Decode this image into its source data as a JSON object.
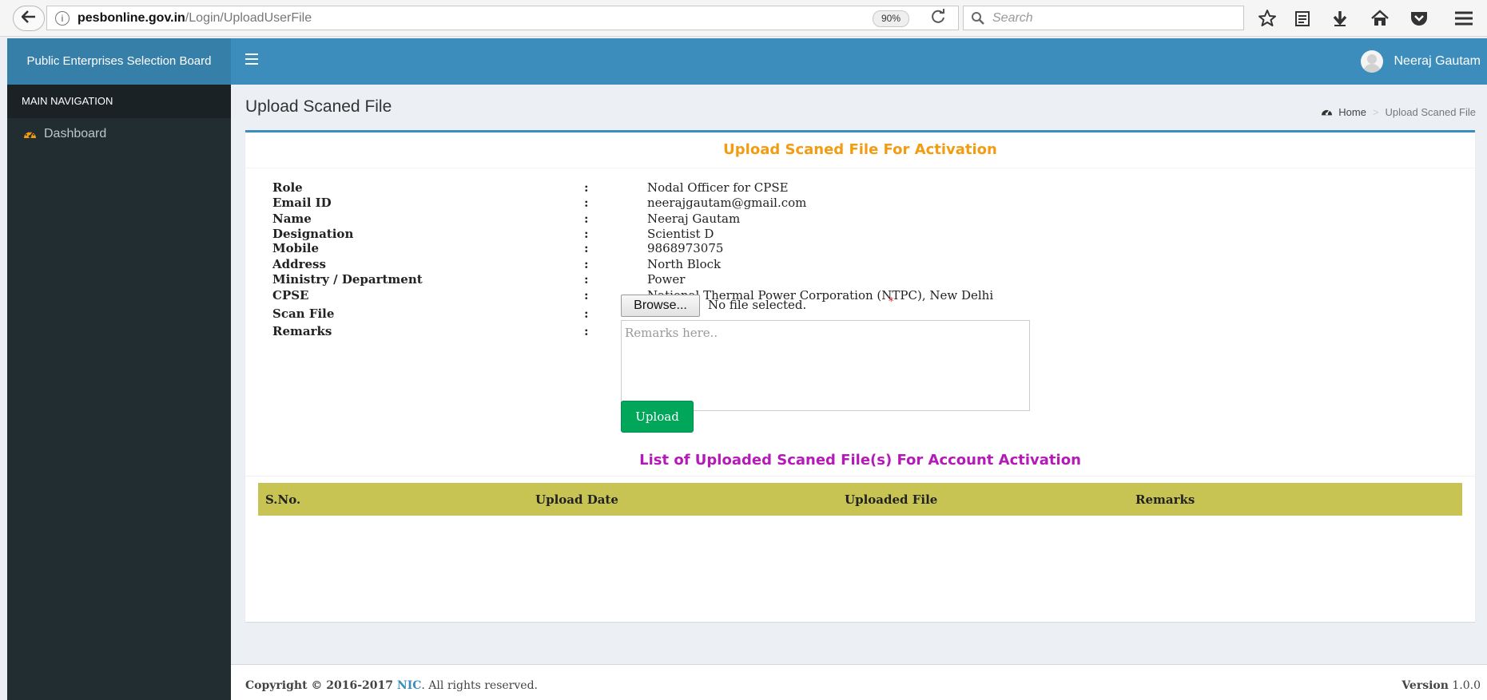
{
  "browser": {
    "url_host": "pesbonline.gov.in",
    "url_path": "/Login/UploadUserFile",
    "zoom": "90%",
    "search_placeholder": "Search",
    "icons": [
      "back-arrow-icon",
      "info-icon",
      "reload-icon",
      "search-icon",
      "star-icon",
      "reading-list-icon",
      "download-icon",
      "home-icon",
      "pocket-icon",
      "menu-icon"
    ]
  },
  "header": {
    "brand": "Public Enterprises Selection Board",
    "user_name": "Neeraj Gautam"
  },
  "sidebar": {
    "header": "MAIN NAVIGATION",
    "items": [
      {
        "label": "Dashboard",
        "icon": "dashboard-icon",
        "icon_color": "#f39c12"
      }
    ]
  },
  "page": {
    "title": "Upload Scaned File",
    "breadcrumb": {
      "home": "Home",
      "current": "Upload Scaned File"
    }
  },
  "form": {
    "title": "Upload Scaned File For Activation",
    "title_color": "#f39c12",
    "fields": [
      {
        "label": "Role",
        "value": "Nodal Officer for CPSE"
      },
      {
        "label": "Email ID",
        "value": "neerajgautam@gmail.com"
      },
      {
        "label": "Name",
        "value": "Neeraj Gautam"
      },
      {
        "label": "Designation",
        "value": "Scientist D"
      },
      {
        "label": "Mobile",
        "value": "9868973075"
      },
      {
        "label": "Address",
        "value": "North Block"
      },
      {
        "label": "Ministry / Department",
        "value": "Power"
      },
      {
        "label": "CPSE",
        "value": "National Thermal Power Corporation (NTPC), New Delhi"
      }
    ],
    "separator": ":",
    "scan_file": {
      "label": "Scan File",
      "browse_label": "Browse...",
      "status": "No file selected.",
      "required_mark": "*"
    },
    "remarks": {
      "label": "Remarks",
      "placeholder": "Remarks here.."
    },
    "upload_label": "Upload",
    "upload_color": "#00a65a"
  },
  "list": {
    "title": "List of Uploaded Scaned File(s) For Account Activation",
    "title_color": "#b41ab7",
    "columns": [
      "S.No.",
      "Upload Date",
      "Uploaded File",
      "Remarks"
    ],
    "header_color": "#c8c454",
    "rows": []
  },
  "footer": {
    "copyright_prefix": "Copyright © 2016-2017",
    "org": "NIC",
    "suffix": ". All rights reserved.",
    "version_label": "Version",
    "version": "1.0.0"
  }
}
